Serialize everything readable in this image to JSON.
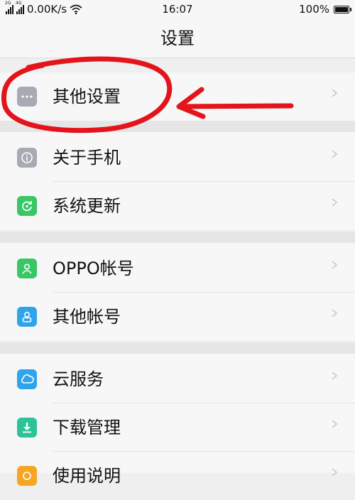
{
  "status_bar": {
    "network_type": "4G",
    "speed": "0.00K/s",
    "time": "16:07",
    "battery": "100%",
    "battery_level": 1.0
  },
  "header": {
    "title": "设置"
  },
  "sections": [
    {
      "items": [
        {
          "label": "其他设置",
          "icon": "more-dots-icon",
          "color": "#a7aab3"
        }
      ]
    },
    {
      "items": [
        {
          "label": "关于手机",
          "icon": "info-icon",
          "color": "#a7aab3"
        },
        {
          "label": "系统更新",
          "icon": "update-icon",
          "color": "#38c764"
        }
      ]
    },
    {
      "items": [
        {
          "label": "OPPO帐号",
          "icon": "oppo-account-icon",
          "color": "#38c764"
        },
        {
          "label": "其他帐号",
          "icon": "account-icon",
          "color": "#2ea5ea"
        }
      ]
    },
    {
      "items": [
        {
          "label": "云服务",
          "icon": "cloud-icon",
          "color": "#2ea5ea"
        },
        {
          "label": "下载管理",
          "icon": "download-icon",
          "color": "#2dc399"
        },
        {
          "label": "使用说明",
          "icon": "help-icon",
          "color": "#f6a623"
        }
      ]
    }
  ],
  "annotation": {
    "type": "circle-with-arrow",
    "color": "#e3141b",
    "target": "其他设置"
  }
}
